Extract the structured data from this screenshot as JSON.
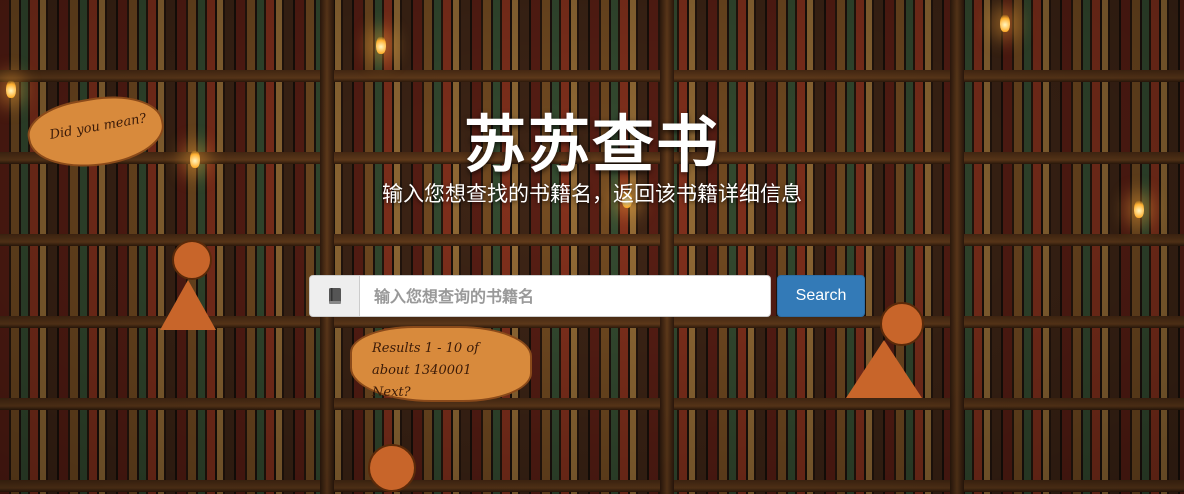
{
  "header": {
    "title": "苏苏查书",
    "subtitle": "输入您想查找的书籍名，返回该书籍详细信息"
  },
  "search": {
    "placeholder": "输入您想查询的书籍名",
    "value": "",
    "button_label": "Search",
    "addon_icon": "book-icon"
  },
  "background": {
    "bubble_left": "Did you mean?",
    "bubble_center": "Results 1 - 10 of about 1340001 Next?"
  },
  "colors": {
    "button": "#337ab7",
    "title": "#ffffff"
  }
}
